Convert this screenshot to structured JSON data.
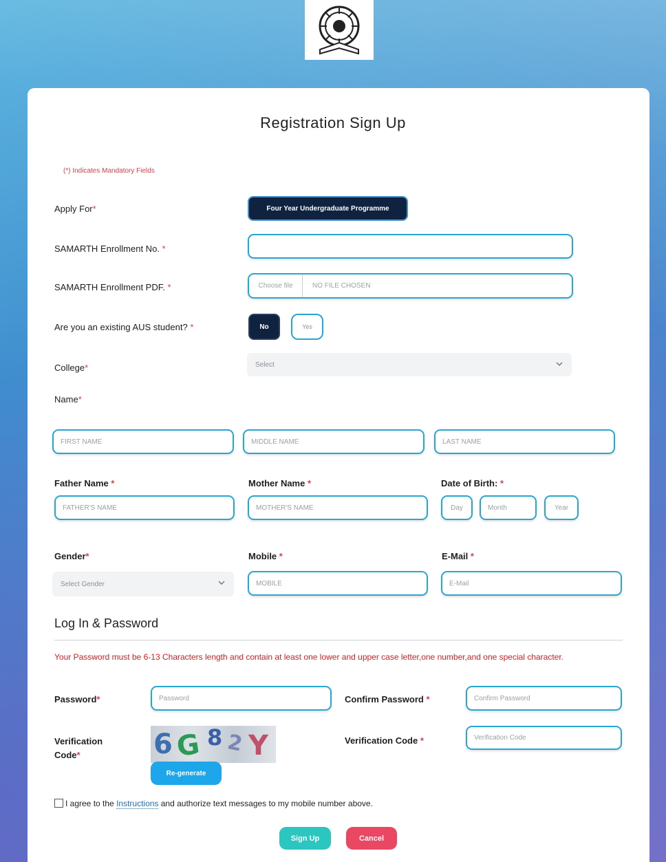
{
  "header": {
    "logo_icon": "university-seal-icon"
  },
  "form": {
    "title": "Registration Sign Up",
    "mandatory_note": "(*) Indicates Mandatory Fields",
    "required_marker": "*",
    "apply_for": {
      "label": "Apply For",
      "button": "Four Year Undergraduate Programme"
    },
    "enrollment_no": {
      "label": "SAMARTH Enrollment No.",
      "value": ""
    },
    "enrollment_pdf": {
      "label": "SAMARTH Enrollment PDF.",
      "choose_button": "Choose file",
      "file_status": "NO FILE CHOSEN"
    },
    "existing_student": {
      "label": "Are you an existing AUS student?",
      "no_label": "No",
      "yes_label": "Yes"
    },
    "college": {
      "label": "College",
      "selected": "Select"
    },
    "name": {
      "label": "Name",
      "first_placeholder": "FIRST NAME",
      "middle_placeholder": "MIDDLE NAME",
      "last_placeholder": "LAST NAME"
    },
    "father": {
      "label": "Father Name",
      "placeholder": "FATHER'S NAME"
    },
    "mother": {
      "label": "Mother Name",
      "placeholder": "MOTHER'S NAME"
    },
    "dob": {
      "label": "Date of Birth:",
      "day": "Day",
      "month": "Month",
      "year": "Year"
    },
    "gender": {
      "label": "Gender",
      "selected": "Select Gender"
    },
    "mobile": {
      "label": "Mobile",
      "placeholder": "MOBILE"
    },
    "email": {
      "label": "E-Mail",
      "placeholder": "E-Mail"
    }
  },
  "login": {
    "heading": "Log In & Password",
    "password_rule": "Your Password must be 6-13 Characters length and contain at least one lower and upper case letter,one number,and one special character.",
    "password": {
      "label": "Password",
      "placeholder": "Password"
    },
    "confirm": {
      "label": "Confirm Password",
      "placeholder": "Confirm Password"
    },
    "verification": {
      "label": "Verification Code",
      "captcha_chars": [
        "6",
        "G",
        "8",
        "2",
        "Y"
      ],
      "regen_button": "Re-generate",
      "input_label": "Verification Code",
      "input_placeholder": "Verification Code"
    }
  },
  "agreement": {
    "text_before": "I agree to the ",
    "link_text": "Instructions",
    "text_after": " and authorize text messages to my mobile number above."
  },
  "actions": {
    "signup": "Sign Up",
    "cancel": "Cancel"
  },
  "colors": {
    "accent_border": "#27a6d2",
    "dark_button": "#0f2340",
    "signup": "#2bc6c0",
    "cancel": "#ea4763",
    "regen": "#1da6ea",
    "mandatory": "#d8424b"
  }
}
